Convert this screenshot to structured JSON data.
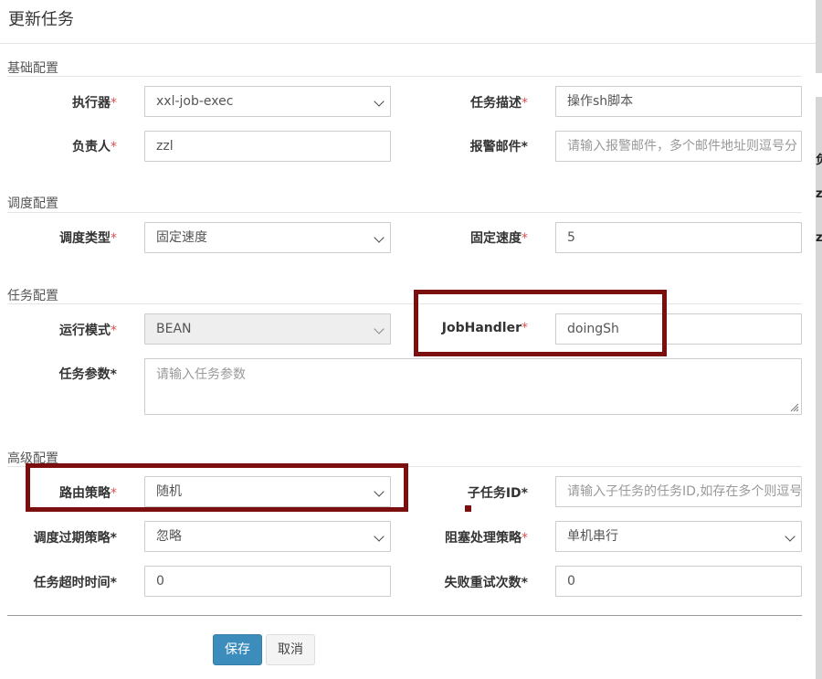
{
  "dialog": {
    "title": "更新任务",
    "save_label": "保存",
    "cancel_label": "取消"
  },
  "background": {
    "glyph_1": "负",
    "glyph_2": "z",
    "glyph_3": "z"
  },
  "sections": {
    "basic": "基础配置",
    "schedule": "调度配置",
    "job": "任务配置",
    "advanced": "高级配置"
  },
  "fields": {
    "executor": {
      "label": "执行器",
      "value": "xxl-job-exec"
    },
    "job_desc": {
      "label": "任务描述",
      "value": "操作sh脚本"
    },
    "author": {
      "label": "负责人",
      "value": "zzl"
    },
    "alarm_email": {
      "label": "报警邮件",
      "placeholder": "请输入报警邮件，多个邮件地址则逗号分"
    },
    "schedule_type": {
      "label": "调度类型",
      "value": "固定速度"
    },
    "fixed_rate": {
      "label": "固定速度",
      "value": "5"
    },
    "run_mode": {
      "label": "运行模式",
      "value": "BEAN"
    },
    "job_handler": {
      "label": "JobHandler",
      "value": "doingSh"
    },
    "job_param": {
      "label": "任务参数",
      "placeholder": "请输入任务参数"
    },
    "route_strategy": {
      "label": "路由策略",
      "value": "随机"
    },
    "child_job_id": {
      "label": "子任务ID",
      "placeholder": "请输入子任务的任务ID,如存在多个则逗号"
    },
    "misfire_strategy": {
      "label": "调度过期策略",
      "value": "忽略"
    },
    "block_strategy": {
      "label": "阻塞处理策略",
      "value": "单机串行"
    },
    "timeout": {
      "label": "任务超时时间",
      "value": "0"
    },
    "fail_retry": {
      "label": "失败重试次数",
      "value": "0"
    }
  },
  "colors": {
    "highlight": "#7b0e0e",
    "primary": "#3c8dbc",
    "required": "#d9534f"
  }
}
